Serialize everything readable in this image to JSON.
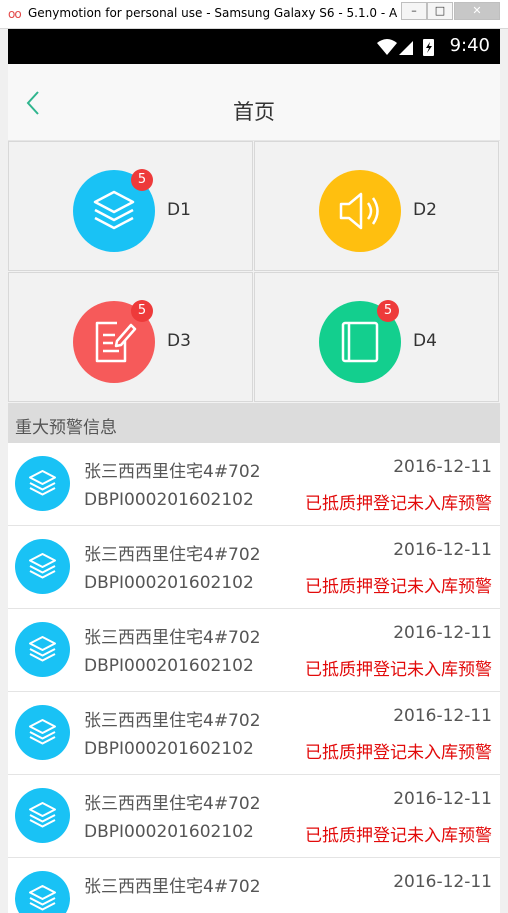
{
  "window": {
    "title": "Genymotion for personal use - Samsung Galaxy S6 - 5.1.0 - A...",
    "logo": "oo",
    "min_label": "–",
    "max_label": "□",
    "close_label": "✕"
  },
  "status_bar": {
    "time": "9:40"
  },
  "header": {
    "title": "首页",
    "back_icon": "chevron-left-icon"
  },
  "grid": {
    "items": [
      {
        "label": "D1",
        "badge": "5",
        "color": "#19c2f5",
        "icon": "layers-icon"
      },
      {
        "label": "D2",
        "badge": "",
        "color": "#ffbf0f",
        "icon": "speaker-icon"
      },
      {
        "label": "D3",
        "badge": "5",
        "color": "#f65a5a",
        "icon": "note-edit-icon"
      },
      {
        "label": "D4",
        "badge": "5",
        "color": "#13cf8e",
        "icon": "book-icon"
      }
    ]
  },
  "section": {
    "title": "重大预警信息"
  },
  "list": {
    "items": [
      {
        "name": "张三西西里住宅4#702",
        "date": "2016-12-11",
        "code": "DBPI000201602102",
        "warning": "已抵质押登记未入库预警"
      },
      {
        "name": "张三西西里住宅4#702",
        "date": "2016-12-11",
        "code": "DBPI000201602102",
        "warning": "已抵质押登记未入库预警"
      },
      {
        "name": "张三西西里住宅4#702",
        "date": "2016-12-11",
        "code": "DBPI000201602102",
        "warning": "已抵质押登记未入库预警"
      },
      {
        "name": "张三西西里住宅4#702",
        "date": "2016-12-11",
        "code": "DBPI000201602102",
        "warning": "已抵质押登记未入库预警"
      },
      {
        "name": "张三西西里住宅4#702",
        "date": "2016-12-11",
        "code": "DBPI000201602102",
        "warning": "已抵质押登记未入库预警"
      },
      {
        "name": "张三西西里住宅4#702",
        "date": "2016-12-11",
        "code": "",
        "warning": ""
      }
    ]
  },
  "colors": {
    "accent": "#19c2f5",
    "warning": "#e20a0a",
    "back": "#2fb58e"
  }
}
